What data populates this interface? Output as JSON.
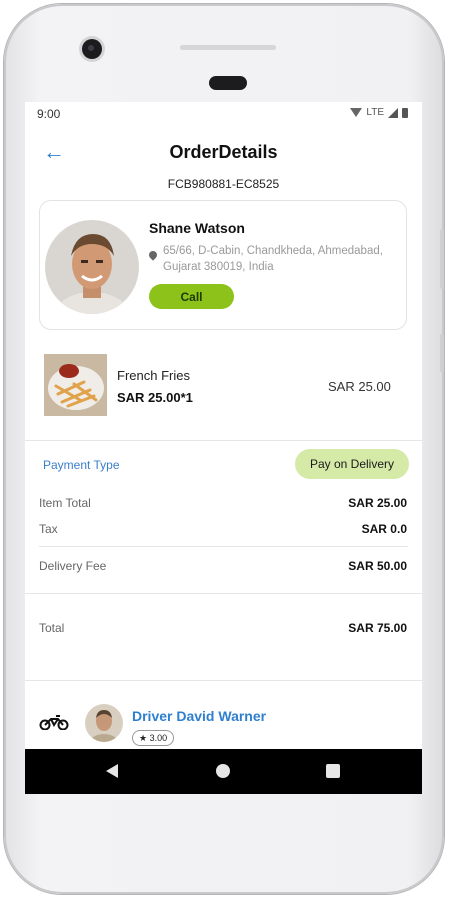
{
  "status": {
    "time": "9:00",
    "network": "LTE"
  },
  "header": {
    "title": "OrderDetails",
    "order_id": "FCB980881-EC8525"
  },
  "customer": {
    "name": "Shane Watson",
    "address": "65/66, D-Cabin, Chandkheda, Ahmedabad, Gujarat 380019, India",
    "call_label": "Call"
  },
  "item": {
    "name": "French Fries",
    "qty_line": "SAR 25.00*1",
    "price": "SAR 25.00"
  },
  "payment": {
    "label": "Payment Type",
    "method": "Pay on Delivery",
    "rows": [
      {
        "label": "Item Total",
        "value": "SAR 25.00"
      },
      {
        "label": "Tax",
        "value": "SAR 0.0"
      },
      {
        "label": "Delivery Fee",
        "value": "SAR 50.00"
      }
    ],
    "total_label": "Total",
    "total_value": "SAR 75.00"
  },
  "driver": {
    "name": "Driver David Warner",
    "rating": "★ 3.00"
  },
  "colors": {
    "accent_blue": "#2f7fd0",
    "call_green": "#8cc21a",
    "badge_green": "#d5eaa6"
  },
  "icons": [
    "back-arrow-icon",
    "location-pin-icon",
    "motorbike-icon",
    "nav-back-icon",
    "nav-home-icon",
    "nav-recents-icon"
  ]
}
